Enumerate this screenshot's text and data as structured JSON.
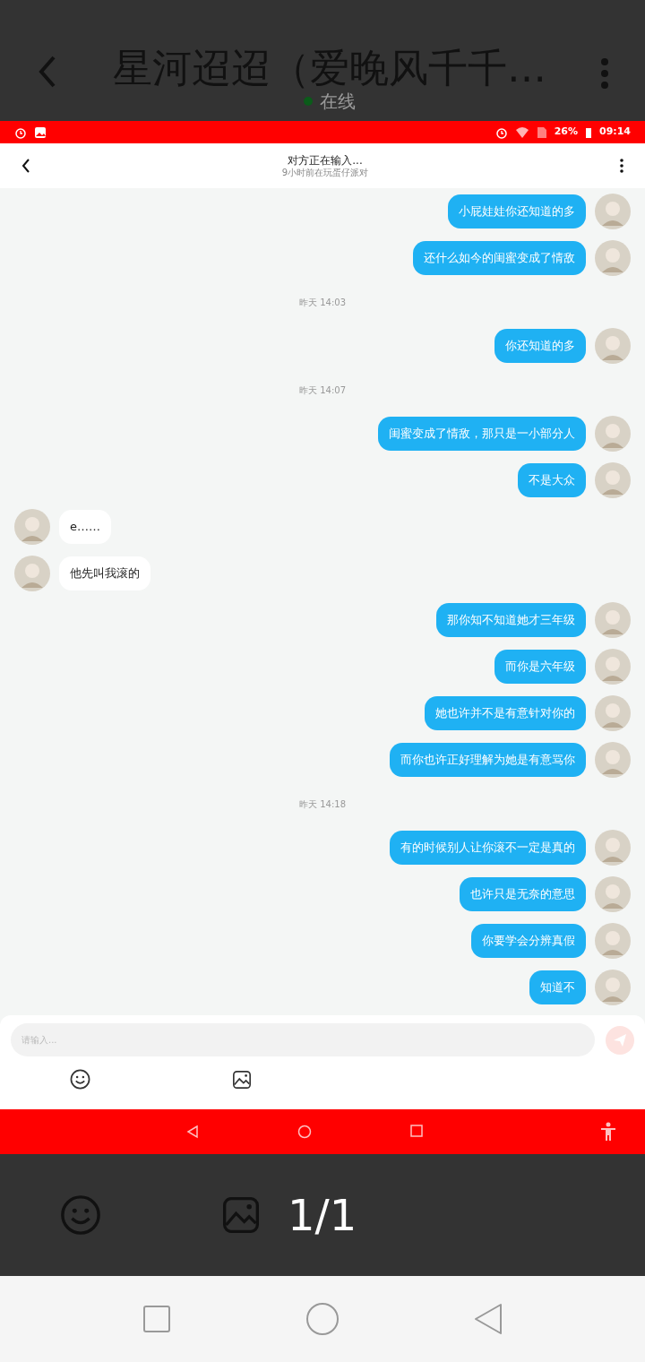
{
  "viewer": {
    "title": "星河迢迢（爱晚风千千…",
    "presence": "在线",
    "page": "1/1"
  },
  "status_bar": {
    "battery": "26%",
    "time": "09:14"
  },
  "chat_header": {
    "title": "对方正在输入...",
    "subtitle": "9小时前在玩蛋仔派对"
  },
  "messages": [
    {
      "kind": "out",
      "text": "小屁娃娃你还知道的多"
    },
    {
      "kind": "out",
      "text": "还什么如今的闺蜜变成了情敌"
    },
    {
      "kind": "time",
      "text": "昨天 14:03"
    },
    {
      "kind": "out",
      "text": "你还知道的多"
    },
    {
      "kind": "time",
      "text": "昨天 14:07"
    },
    {
      "kind": "out",
      "text": "闺蜜变成了情敌，那只是一小部分人"
    },
    {
      "kind": "out",
      "text": "不是大众"
    },
    {
      "kind": "in",
      "text": "e……"
    },
    {
      "kind": "in",
      "text": "他先叫我滚的"
    },
    {
      "kind": "out",
      "text": "那你知不知道她才三年级"
    },
    {
      "kind": "out",
      "text": "而你是六年级"
    },
    {
      "kind": "out",
      "text": "她也许并不是有意针对你的"
    },
    {
      "kind": "out",
      "text": "而你也许正好理解为她是有意骂你"
    },
    {
      "kind": "time",
      "text": "昨天 14:18"
    },
    {
      "kind": "out",
      "text": "有的时候别人让你滚不一定是真的"
    },
    {
      "kind": "out",
      "text": "也许只是无奈的意思"
    },
    {
      "kind": "out",
      "text": "你要学会分辨真假"
    },
    {
      "kind": "out",
      "text": "知道不"
    }
  ],
  "composer": {
    "placeholder": "请输入..."
  }
}
